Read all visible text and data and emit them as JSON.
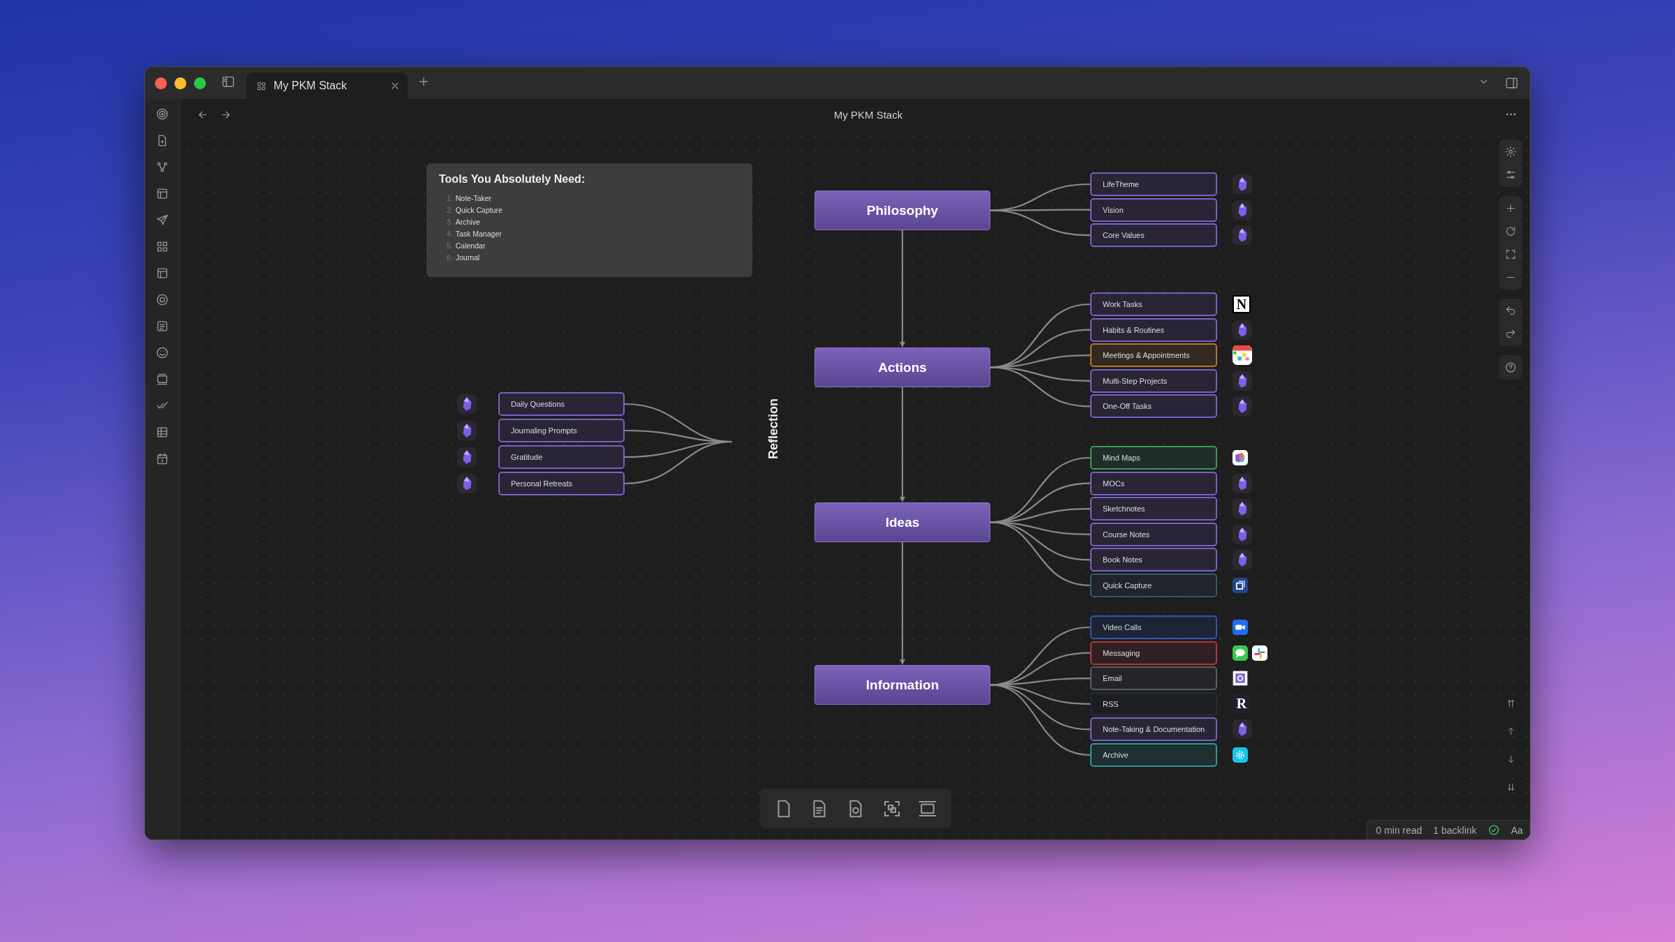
{
  "window": {
    "tab": {
      "title": "My PKM Stack",
      "selected": true
    },
    "title": "My PKM Stack"
  },
  "card": {
    "title": "Tools You Absolutely Need:",
    "items": [
      {
        "number": "1.",
        "text": "Note-Taker"
      },
      {
        "number": "2.",
        "text": "Quick Capture"
      },
      {
        "number": "3.",
        "text": "Archive"
      },
      {
        "number": "4.",
        "text": "Task Manager"
      },
      {
        "number": "5.",
        "text": "Calendar"
      },
      {
        "number": "6.",
        "text": "Journal"
      }
    ]
  },
  "reflection": {
    "label": "Reflection",
    "items": [
      {
        "label": "Daily Questions",
        "color": "#7c5fc4",
        "icons": [
          {
            "kind": "gem"
          }
        ]
      },
      {
        "label": "Journaling Prompts",
        "color": "#7c5fc4",
        "icons": [
          {
            "kind": "gem"
          }
        ]
      },
      {
        "label": "Gratitude",
        "color": "#7c5fc4",
        "icons": [
          {
            "kind": "gem"
          }
        ]
      },
      {
        "label": "Personal Retreats",
        "color": "#7c5fc4",
        "icons": [
          {
            "kind": "gem"
          }
        ]
      }
    ]
  },
  "branches": [
    {
      "label": "Philosophy",
      "children": [
        {
          "label": "LifeTheme",
          "color": "#7c5fc4",
          "icons": [
            {
              "kind": "gem"
            }
          ]
        },
        {
          "label": "Vision",
          "color": "#7c5fc4",
          "icons": [
            {
              "kind": "gem"
            }
          ]
        },
        {
          "label": "Core Values",
          "color": "#7c5fc4",
          "icons": [
            {
              "kind": "gem"
            }
          ]
        }
      ]
    },
    {
      "label": "Actions",
      "children": [
        {
          "label": "Work Tasks",
          "color": "#7c5fc4",
          "icons": [
            {
              "kind": "letter_light",
              "text": "N"
            }
          ]
        },
        {
          "label": "Habits & Routines",
          "color": "#7c5fc4",
          "icons": [
            {
              "kind": "gem"
            }
          ]
        },
        {
          "label": "Meetings & Appointments",
          "color": "#b8762c",
          "icons": [
            {
              "kind": "calendar"
            }
          ]
        },
        {
          "label": "Multi-Step Projects",
          "color": "#7c5fc4",
          "icons": [
            {
              "kind": "gem"
            }
          ]
        },
        {
          "label": "One-Off Tasks",
          "color": "#7c5fc4",
          "icons": [
            {
              "kind": "gem"
            }
          ]
        }
      ]
    },
    {
      "label": "Ideas",
      "children": [
        {
          "label": "Mind Maps",
          "color": "#3a9a5a",
          "icons": [
            {
              "kind": "mindmap"
            }
          ]
        },
        {
          "label": "MOCs",
          "color": "#7c5fc4",
          "icons": [
            {
              "kind": "gem"
            }
          ]
        },
        {
          "label": "Sketchnotes",
          "color": "#7c5fc4",
          "icons": [
            {
              "kind": "gem"
            }
          ]
        },
        {
          "label": "Course Notes",
          "color": "#7c5fc4",
          "icons": [
            {
              "kind": "gem"
            }
          ]
        },
        {
          "label": "Book Notes",
          "color": "#7c5fc4",
          "icons": [
            {
              "kind": "gem"
            }
          ]
        },
        {
          "label": "Quick Capture",
          "color": "#2f5a68",
          "icons": [
            {
              "kind": "frame"
            }
          ]
        }
      ]
    },
    {
      "label": "Information",
      "children": [
        {
          "label": "Video Calls",
          "color": "#2d56b8",
          "icons": [
            {
              "kind": "video"
            }
          ]
        },
        {
          "label": "Messaging",
          "color": "#b03838",
          "icons": [
            {
              "kind": "chat"
            },
            {
              "kind": "pinwheel"
            }
          ]
        },
        {
          "label": "Email",
          "color": "#5e5e5e",
          "icons": [
            {
              "kind": "stamp"
            }
          ]
        },
        {
          "label": "RSS",
          "color": "#222a3e",
          "icons": [
            {
              "kind": "letter_dark",
              "text": "R"
            }
          ]
        },
        {
          "label": "Note-Taking & Documentation",
          "color": "#7c5fc4",
          "icons": [
            {
              "kind": "gem"
            }
          ]
        },
        {
          "label": "Archive",
          "color": "#2a9a98",
          "icons": [
            {
              "kind": "swirl"
            }
          ]
        }
      ]
    }
  ],
  "status_bar": {
    "read_time": "0 min read",
    "backlinks": "1 backlink",
    "format": "Aa"
  }
}
